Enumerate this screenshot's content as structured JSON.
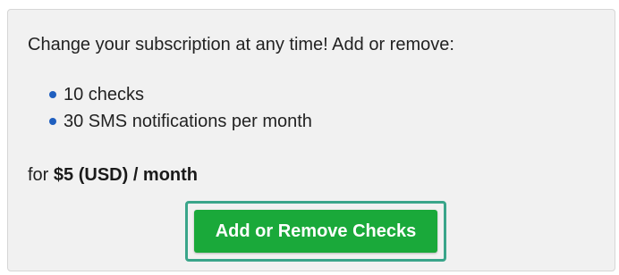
{
  "subscription": {
    "intro_text": "Change your subscription at any time! Add or remove:",
    "features": [
      {
        "label": "10 checks"
      },
      {
        "label": "30 SMS notifications per month"
      }
    ],
    "price_prefix": "for ",
    "price_value": "$5 (USD) / month",
    "action_button_label": "Add or Remove Checks"
  },
  "colors": {
    "panel_background": "#f1f1f1",
    "bullet": "#1f5fbf",
    "button_background": "#1aa93a",
    "button_focus_outline": "#3aa58a",
    "button_text": "#ffffff"
  }
}
